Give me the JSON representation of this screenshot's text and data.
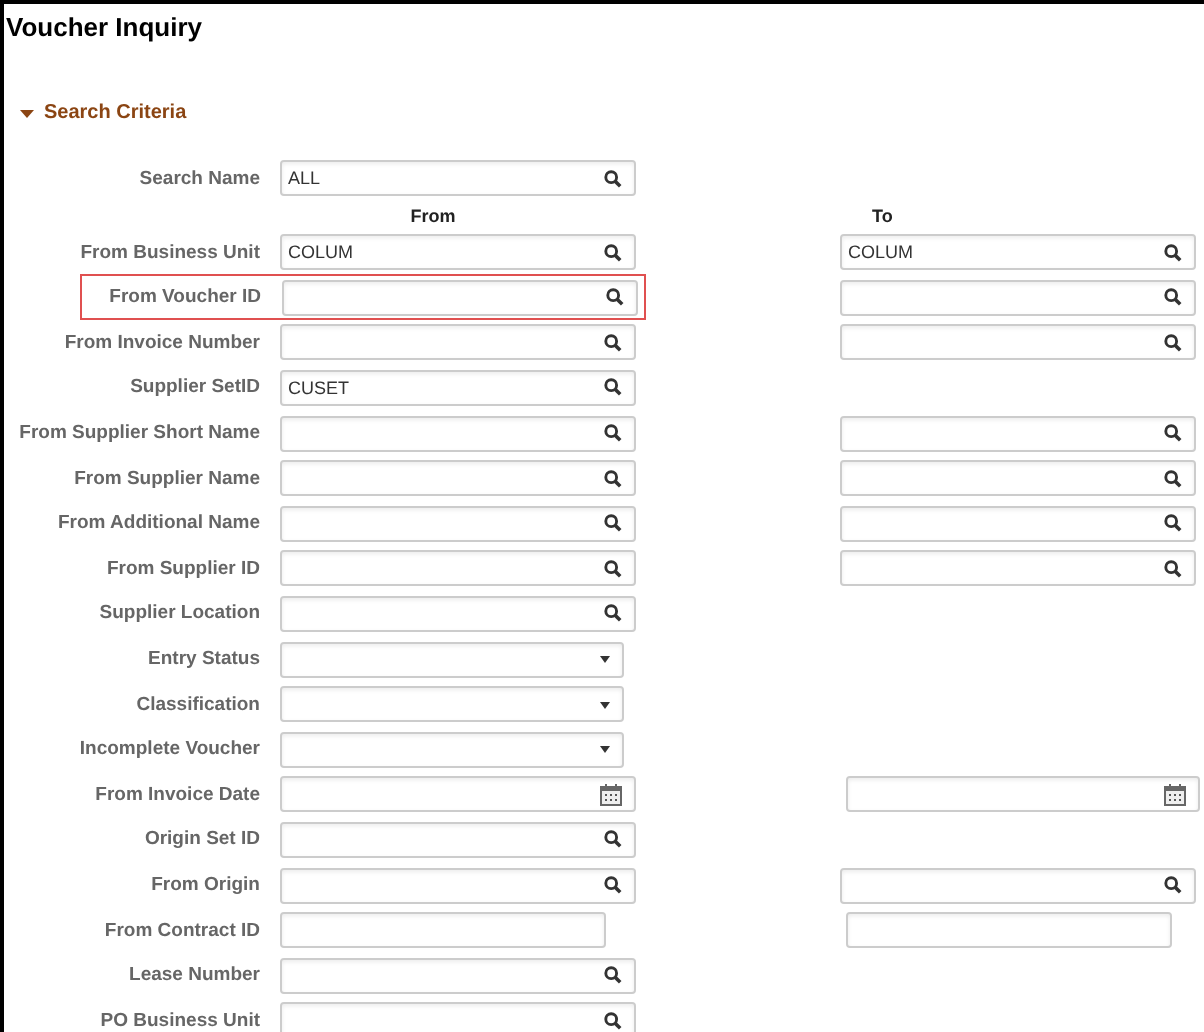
{
  "page": {
    "title": "Voucher Inquiry"
  },
  "section": {
    "title": "Search Criteria",
    "expanded": true
  },
  "search_name": {
    "label": "Search Name",
    "value": "ALL",
    "kind": "lookup"
  },
  "range_headers": {
    "from": "From",
    "to": "To"
  },
  "rows": [
    {
      "label": "From Business Unit",
      "highlighted": false,
      "from": {
        "kind": "lookup",
        "value": "COLUM"
      },
      "to": {
        "kind": "lookup",
        "value": "COLUM"
      }
    },
    {
      "label": "From Voucher ID",
      "highlighted": true,
      "from": {
        "kind": "lookup"
      },
      "to": {
        "kind": "lookup"
      }
    },
    {
      "label": "From Invoice Number",
      "highlighted": false,
      "from": {
        "kind": "lookup"
      },
      "to": {
        "kind": "lookup"
      }
    },
    {
      "label": "Supplier SetID",
      "highlighted": false,
      "from": {
        "kind": "lookup",
        "value": "CUSET"
      }
    },
    {
      "label": "From Supplier Short Name",
      "highlighted": false,
      "from": {
        "kind": "lookup"
      },
      "to": {
        "kind": "lookup"
      }
    },
    {
      "label": "From Supplier Name",
      "highlighted": false,
      "from": {
        "kind": "lookup"
      },
      "to": {
        "kind": "lookup"
      }
    },
    {
      "label": "From Additional Name",
      "highlighted": false,
      "from": {
        "kind": "lookup"
      },
      "to": {
        "kind": "lookup"
      }
    },
    {
      "label": "From Supplier ID",
      "highlighted": false,
      "from": {
        "kind": "lookup"
      },
      "to": {
        "kind": "lookup"
      }
    },
    {
      "label": "Supplier Location",
      "highlighted": false,
      "from": {
        "kind": "lookup"
      }
    },
    {
      "label": "Entry Status",
      "highlighted": false,
      "from": {
        "kind": "select"
      }
    },
    {
      "label": "Classification",
      "highlighted": false,
      "from": {
        "kind": "select"
      }
    },
    {
      "label": "Incomplete Voucher",
      "highlighted": false,
      "from": {
        "kind": "select"
      }
    },
    {
      "label": "From Invoice Date",
      "highlighted": false,
      "from": {
        "kind": "date"
      },
      "to": {
        "kind": "date"
      }
    },
    {
      "label": "Origin Set ID",
      "highlighted": false,
      "from": {
        "kind": "lookup"
      }
    },
    {
      "label": "From Origin",
      "highlighted": false,
      "from": {
        "kind": "lookup"
      },
      "to": {
        "kind": "lookup"
      }
    },
    {
      "label": "From Contract ID",
      "highlighted": false,
      "from": {
        "kind": "text"
      },
      "to": {
        "kind": "text"
      }
    },
    {
      "label": "Lease Number",
      "highlighted": false,
      "from": {
        "kind": "lookup"
      }
    },
    {
      "label": "PO Business Unit",
      "highlighted": false,
      "from": {
        "kind": "lookup"
      }
    }
  ]
}
